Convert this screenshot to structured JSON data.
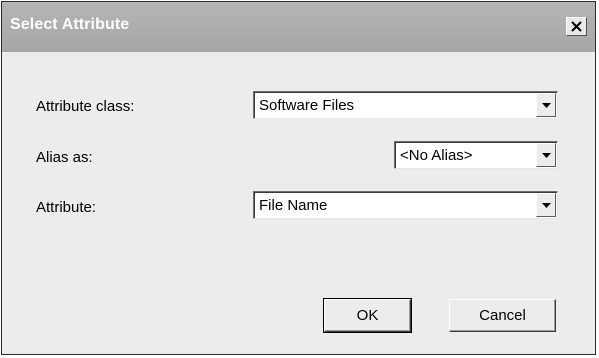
{
  "dialog": {
    "title": "Select Attribute",
    "close_glyph": "✕"
  },
  "form": {
    "attribute_class": {
      "label": "Attribute class:",
      "value": "Software Files"
    },
    "alias_as": {
      "label": "Alias as:",
      "value": "<No Alias>"
    },
    "attribute": {
      "label": "Attribute:",
      "value": "File Name"
    }
  },
  "buttons": {
    "ok": "OK",
    "cancel": "Cancel"
  },
  "icons": {
    "close": "close-icon",
    "dropdown": "chevron-down-icon"
  }
}
